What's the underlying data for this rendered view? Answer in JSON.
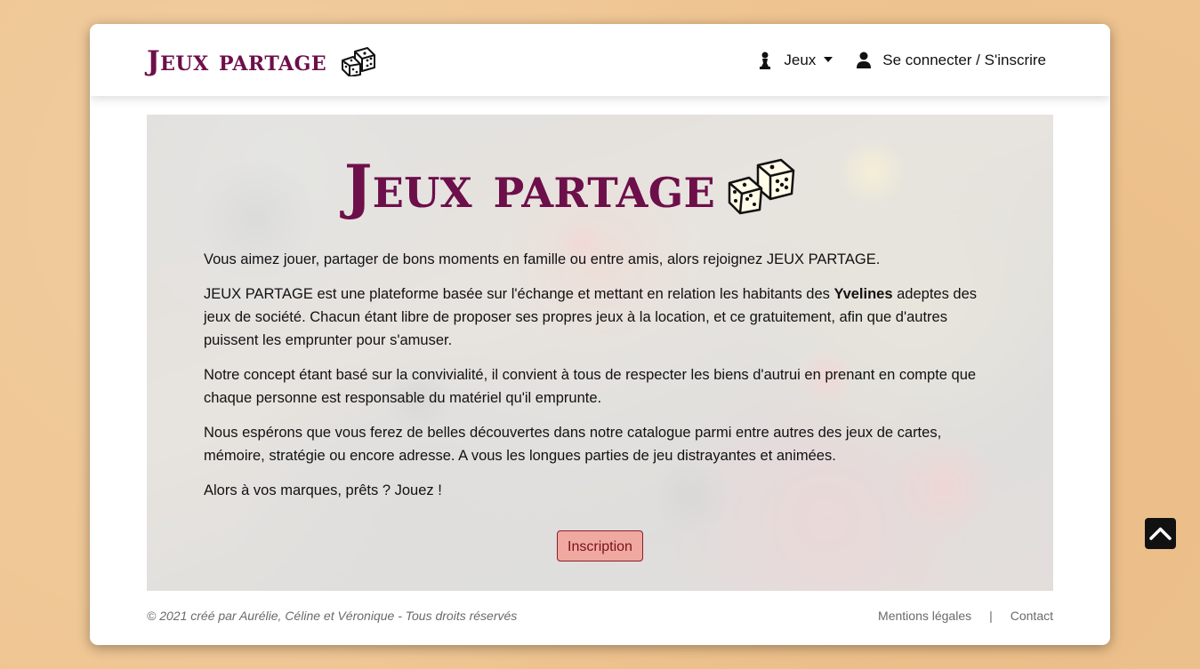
{
  "header": {
    "brand_text": "Jeux partage",
    "brand_icon": "dice-icon",
    "nav": {
      "games_label": "Jeux",
      "games_icon": "pawn-icon",
      "login_label": "Se connecter / S'inscrire",
      "login_icon": "user-icon"
    }
  },
  "hero": {
    "title": "Jeux partage",
    "title_icon": "dice-icon",
    "paragraphs": {
      "p1": "Vous aimez jouer, partager de bons moments en famille ou entre amis, alors rejoignez JEUX PARTAGE.",
      "p2_before": "JEUX PARTAGE est une plateforme basée sur l'échange et mettant en relation les habitants des ",
      "p2_strong": "Yvelines",
      "p2_after": " adeptes des jeux de société. Chacun étant libre de proposer ses propres jeux à la location, et ce gratuitement, afin que d'autres puissent les emprunter pour s'amuser.",
      "p3": "Notre concept étant basé sur la convivialité, il convient à tous de respecter les biens d'autrui en prenant en compte que chaque personne est responsable du matériel qu'il emprunte.",
      "p4": "Nous espérons que vous ferez de belles découvertes dans notre catalogue parmi entre autres des jeux de cartes, mémoire, stratégie ou encore adresse. A vous les longues parties de jeu distrayantes et animées.",
      "p5": "Alors à vos marques, prêts ? Jouez !"
    },
    "button_label": "Inscription"
  },
  "footer": {
    "copyright": "© 2021 créé par Aurélie, Céline et Véronique - Tous droits réservés",
    "legal_label": "Mentions légales",
    "separator": "|",
    "contact_label": "Contact"
  },
  "scroll_top_icon": "chevron-up-icon",
  "colors": {
    "brand": "#6d0f4a",
    "page_background": "#efc592",
    "button_background": "#f0a9a0",
    "button_border": "#8c1c2a"
  }
}
